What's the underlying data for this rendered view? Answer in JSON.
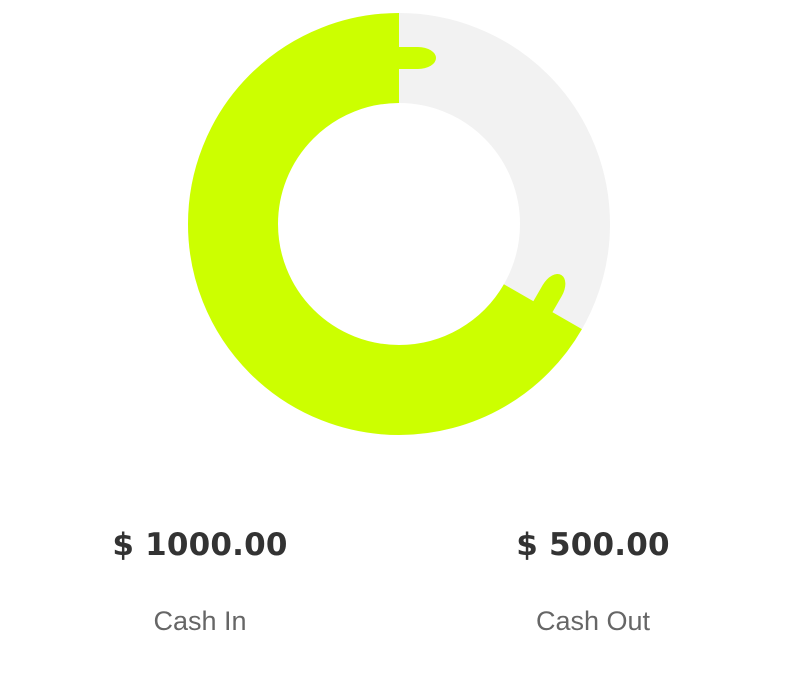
{
  "chart_data": {
    "type": "pie",
    "style": "donut",
    "categories": [
      "Cash In",
      "Cash Out"
    ],
    "values": [
      1000,
      500
    ],
    "slice_colors": [
      "#CCFF00",
      "#F2F2F2"
    ],
    "legend": "none"
  },
  "summary": {
    "cash_in": {
      "amount": "$ 1000.00",
      "label": "Cash In"
    },
    "cash_out": {
      "amount": "$ 500.00",
      "label": "Cash Out"
    }
  }
}
